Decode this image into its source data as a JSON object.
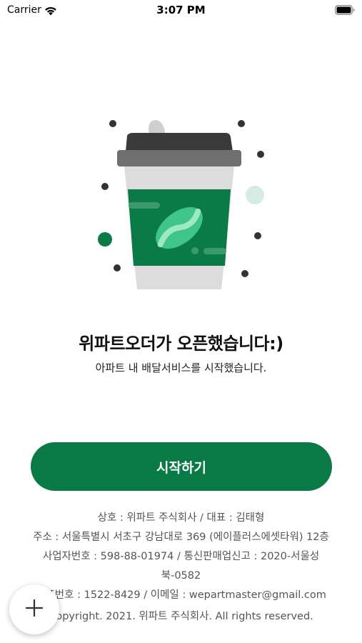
{
  "status_bar": {
    "carrier": "Carrier",
    "time": "3:07 PM"
  },
  "main": {
    "title": "위파트오더가 오픈했습니다:)",
    "subtitle": "아파트 내 배달서비스를 시작했습니다.",
    "start_button_label": "시작하기"
  },
  "footer": {
    "company": "상호 : 위파트 주식회사 / 대표 : 김태형",
    "address": "주소 : 서울특별시 서초구 강남대로 369 (에이플러스에셋타워) 12층",
    "business_reg_line1": "사업자번호 : 598-88-01974 / 통신판매업신고 : 2020-서울성",
    "business_reg_line2": "북-0582",
    "contact": "대표번호 : 1522-8429 / 이메일 : wepartmaster@gmail.com",
    "copyright": "Copyright. 2021. 위파트 주식회사. All rights reserved."
  },
  "fab": {
    "icon": "plus-icon"
  },
  "colors": {
    "brand_green": "#097a46",
    "cup_gray": "#d9d9d9",
    "lid_dark": "#3a3a3a",
    "lid_mid": "#707070",
    "bean_green": "#3fc48a",
    "footer_text": "#555555"
  }
}
